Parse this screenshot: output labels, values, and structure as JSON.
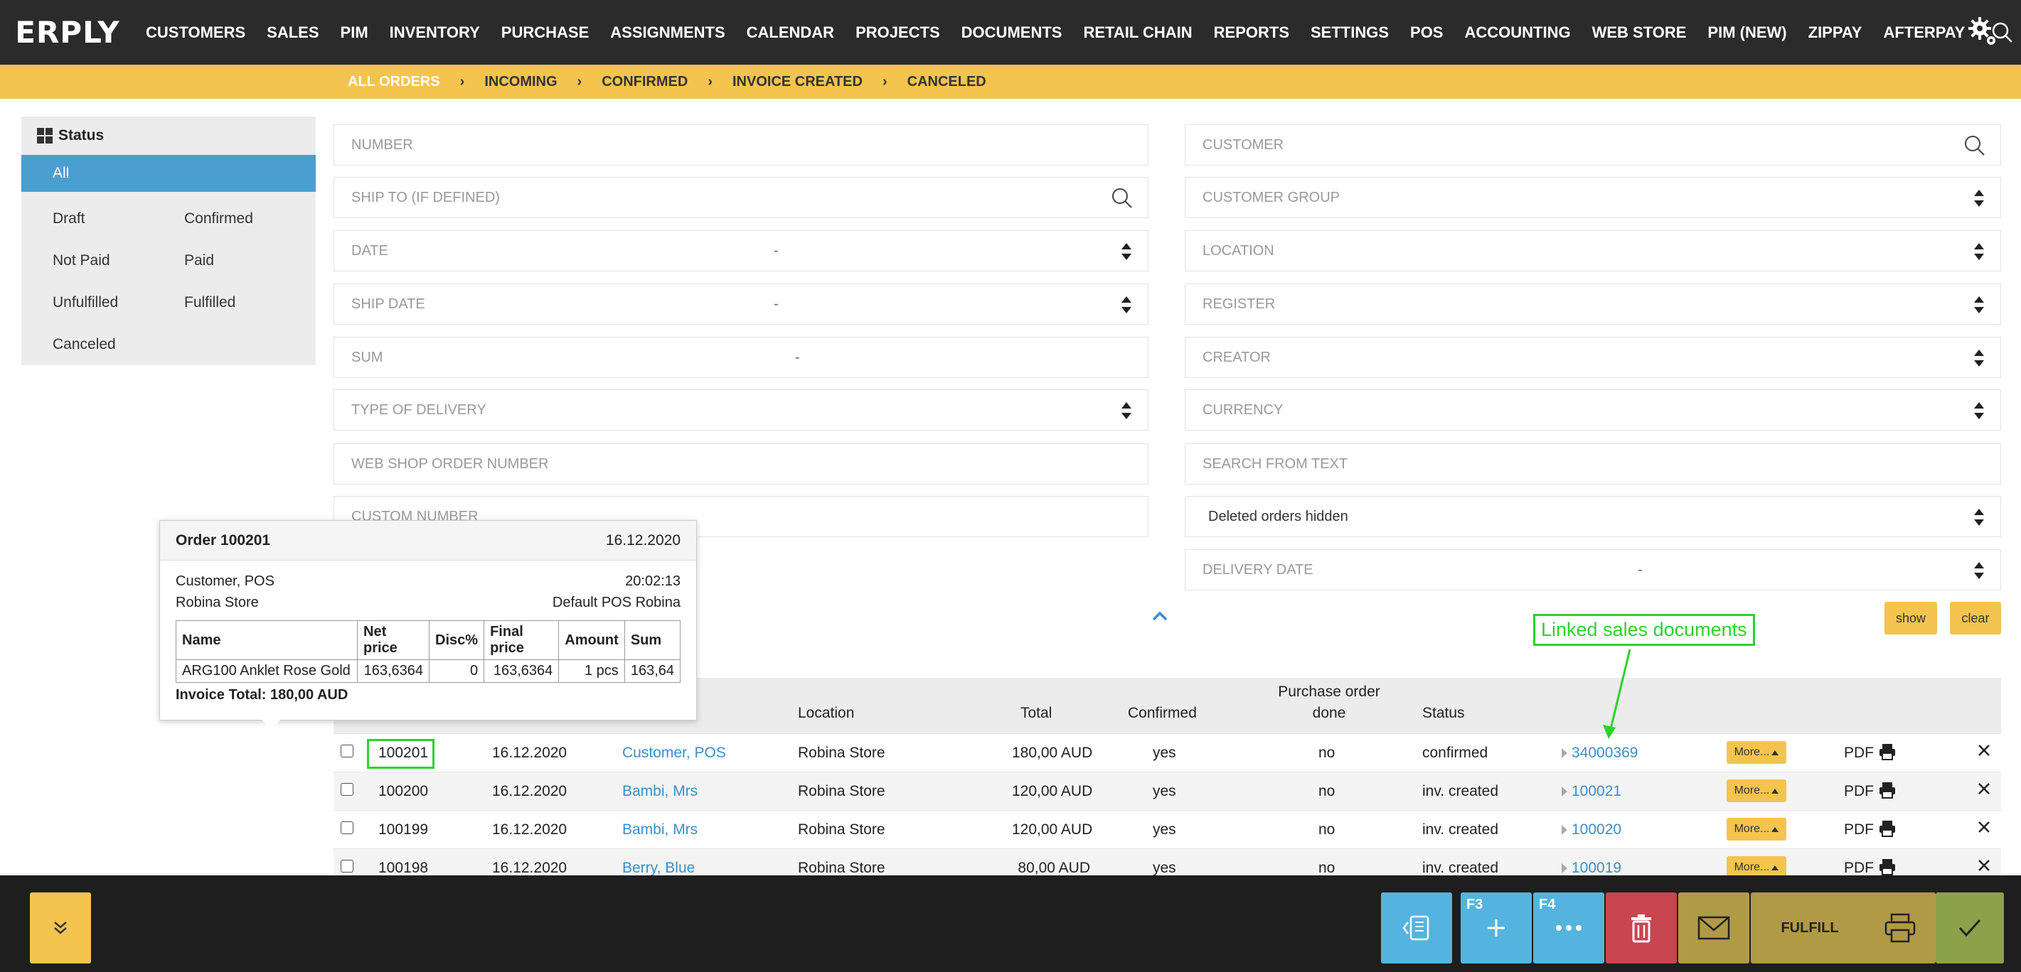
{
  "app": {
    "logo_text": "ERPLY"
  },
  "nav": {
    "items": [
      "CUSTOMERS",
      "SALES",
      "PIM",
      "INVENTORY",
      "PURCHASE",
      "ASSIGNMENTS",
      "CALENDAR",
      "PROJECTS",
      "DOCUMENTS",
      "RETAIL CHAIN",
      "REPORTS",
      "SETTINGS",
      "POS",
      "ACCOUNTING",
      "WEB STORE",
      "PIM (NEW)",
      "ZIPPAY",
      "AFTERPAY"
    ],
    "search_icon": "search-icon",
    "settings_icon": "gear-icon"
  },
  "status_tabs": [
    "ALL ORDERS",
    "INCOMING",
    "CONFIRMED",
    "INVOICE CREATED",
    "CANCELED"
  ],
  "status_sep": "›",
  "left_panel": {
    "title": "Status",
    "all_label": "All",
    "items": [
      "Draft",
      "Confirmed",
      "Not Paid",
      "Paid",
      "Unfulfilled",
      "Fulfilled",
      "Canceled"
    ]
  },
  "filters": {
    "number": "NUMBER",
    "ship_to": "SHIP TO (IF DEFINED)",
    "date": "DATE",
    "ship_date": "SHIP DATE",
    "sum": "SUM",
    "type_of_delivery": "TYPE OF DELIVERY",
    "web_shop_order_number": "WEB SHOP ORDER NUMBER",
    "custom_number": "CUSTOM NUMBER",
    "customer": "CUSTOMER",
    "customer_group": "CUSTOMER GROUP",
    "location": "LOCATION",
    "register": "REGISTER",
    "creator": "CREATOR",
    "currency": "CURRENCY",
    "search_from_text": "SEARCH FROM TEXT",
    "deleted_orders": "Deleted orders hidden",
    "delivery_date": "DELIVERY DATE",
    "dash": "-",
    "show_button": "show",
    "clear_button": "clear"
  },
  "table": {
    "headers": {
      "location": "Location",
      "total": "Total",
      "confirmed": "Confirmed",
      "purchase_order_done_1": "Purchase order",
      "purchase_order_done_2": "done",
      "status": "Status"
    },
    "rows": [
      {
        "number": "100201",
        "date": "16.12.2020",
        "customer": "Customer, POS",
        "location": "Robina Store",
        "total": "180,00 AUD",
        "confirmed": "yes",
        "po_done": "no",
        "status": "confirmed",
        "linked": "34000369",
        "more": "More...",
        "pdf": "PDF"
      },
      {
        "number": "100200",
        "date": "16.12.2020",
        "customer": "Bambi, Mrs",
        "location": "Robina Store",
        "total": "120,00 AUD",
        "confirmed": "yes",
        "po_done": "no",
        "status": "inv. created",
        "linked": "100021",
        "more": "More...",
        "pdf": "PDF"
      },
      {
        "number": "100199",
        "date": "16.12.2020",
        "customer": "Bambi, Mrs",
        "location": "Robina Store",
        "total": "120,00 AUD",
        "confirmed": "yes",
        "po_done": "no",
        "status": "inv. created",
        "linked": "100020",
        "more": "More...",
        "pdf": "PDF"
      },
      {
        "number": "100198",
        "date": "16.12.2020",
        "customer": "Berry, Blue",
        "location": "Robina Store",
        "total": "80,00 AUD",
        "confirmed": "yes",
        "po_done": "no",
        "status": "inv. created",
        "linked": "100019",
        "more": "More...",
        "pdf": "PDF"
      }
    ]
  },
  "annotation": {
    "label": "Linked sales documents"
  },
  "tooltip": {
    "title": "Order 100201",
    "date": "16.12.2020",
    "customer": "Customer, POS",
    "time": "20:02:13",
    "store": "Robina Store",
    "register": "Default POS Robina",
    "columns": [
      "Name",
      "Net price",
      "Disc%",
      "Final price",
      "Amount",
      "Sum"
    ],
    "line": [
      "ARG100 Anklet Rose Gold",
      "163,6364",
      "0",
      "163,6364",
      "1 pcs",
      "163,64"
    ],
    "invoice_total": "Invoice Total: 180,00 AUD"
  },
  "bottom_bar": {
    "f3": "F3",
    "f4": "F4",
    "fulfill": "FULFILL"
  },
  "colors": {
    "accent_yellow": "#f4c44f",
    "nav_dark": "#2b2b2b",
    "link_blue": "#3a8fc8",
    "selected_blue": "#4a9fd0",
    "annotation_green": "#2ed12e"
  }
}
